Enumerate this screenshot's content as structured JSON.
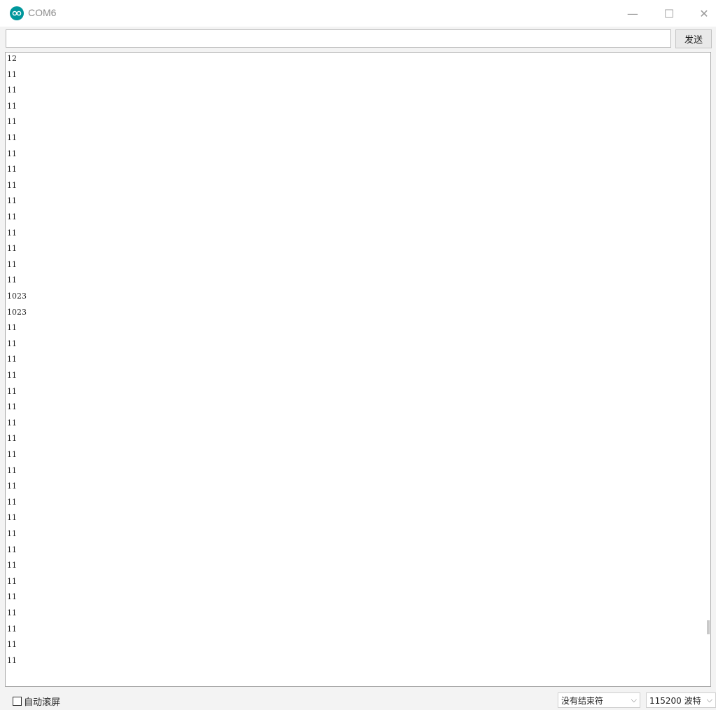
{
  "window": {
    "title": "COM6",
    "controls": {
      "minimize": "—",
      "maximize": "☐",
      "close": "✕"
    }
  },
  "sendbar": {
    "input_value": "",
    "send_label": "发送"
  },
  "output": {
    "lines": [
      "12",
      "11",
      "11",
      "11",
      "11",
      "11",
      "11",
      "11",
      "11",
      "11",
      "11",
      "11",
      "11",
      "11",
      "11",
      "1023",
      "1023",
      "11",
      "11",
      "11",
      "11",
      "11",
      "11",
      "11",
      "11",
      "11",
      "11",
      "11",
      "11",
      "11",
      "11",
      "11",
      "11",
      "11",
      "11",
      "11",
      "11",
      "11",
      "11"
    ]
  },
  "footer": {
    "autoscroll_label": "自动滚屏",
    "autoscroll_checked": false,
    "line_ending": "没有结束符",
    "baud": "115200 波特"
  },
  "colors": {
    "brand": "#00979c",
    "background": "#f3f3f3"
  },
  "icons": {
    "app": "arduino-logo-icon",
    "dropdown": "chevron-down-icon"
  }
}
